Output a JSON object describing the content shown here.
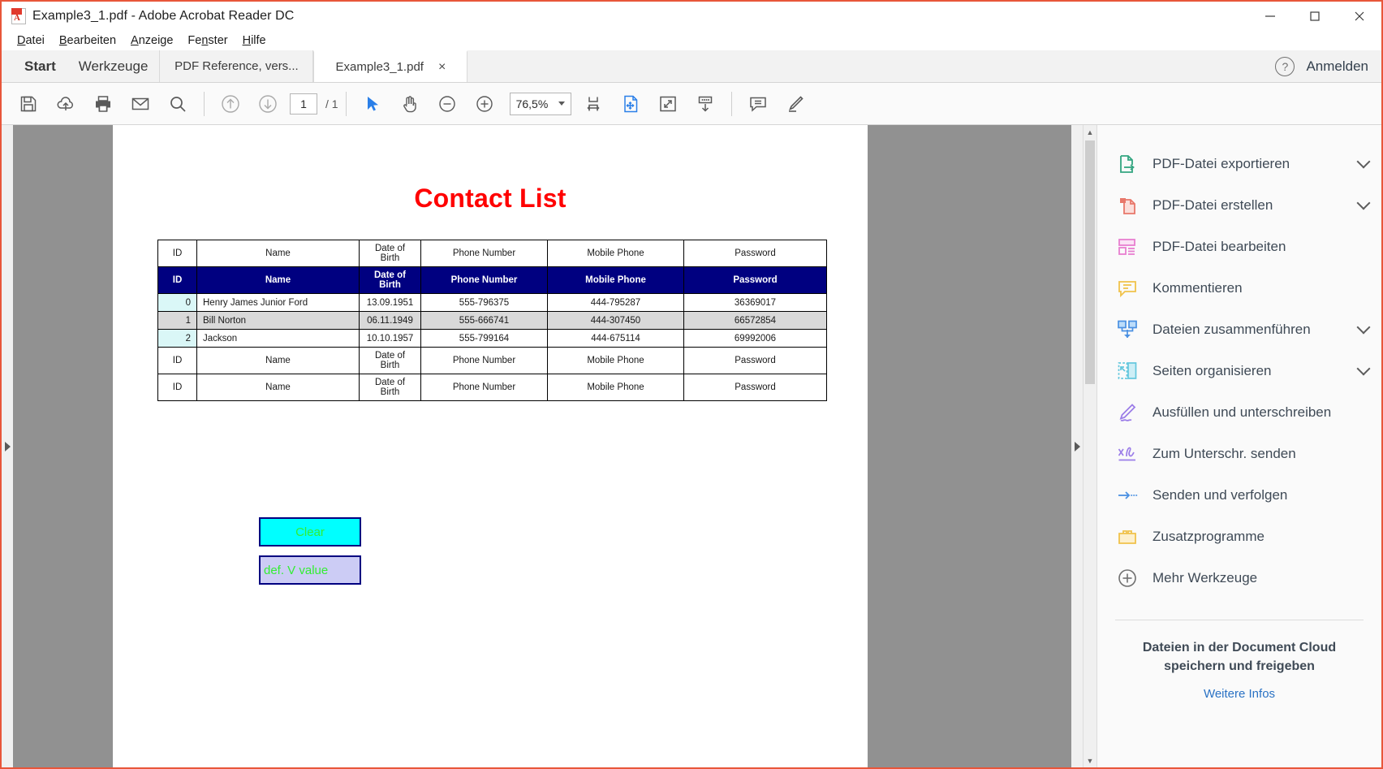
{
  "window": {
    "title": "Example3_1.pdf - Adobe Acrobat Reader DC",
    "app_icon": "pdf-document-icon",
    "minimize": "minimize-icon",
    "maximize": "maximize-icon",
    "close": "close-icon"
  },
  "menubar": {
    "items": [
      {
        "label": "Datei",
        "accel": "D"
      },
      {
        "label": "Bearbeiten",
        "accel": "B"
      },
      {
        "label": "Anzeige",
        "accel": "A"
      },
      {
        "label": "Fenster",
        "accel": "n"
      },
      {
        "label": "Hilfe",
        "accel": "H"
      }
    ]
  },
  "tabbar": {
    "home_label": "Start",
    "tools_label": "Werkzeuge",
    "doc_tabs": [
      {
        "label": "PDF Reference, vers...",
        "active": false,
        "close": ""
      },
      {
        "label": "Example3_1.pdf",
        "active": true,
        "close": "×"
      }
    ],
    "help_glyph": "?",
    "signin_label": "Anmelden"
  },
  "toolbar": {
    "icons": [
      {
        "name": "save-icon",
        "title": "Speichern"
      },
      {
        "name": "upload-cloud-icon",
        "title": "In Cloud speichern"
      },
      {
        "name": "print-icon",
        "title": "Drucken"
      },
      {
        "name": "email-icon",
        "title": "E-Mail"
      },
      {
        "name": "search-icon",
        "title": "Suchen"
      }
    ],
    "prev_page_icon": "arrow-up-circle-icon",
    "next_page_icon": "arrow-down-circle-icon",
    "page_number": "1",
    "page_total": "/ 1",
    "select_tool_icon": "cursor-arrow-icon",
    "hand_tool_icon": "hand-icon",
    "zoom_out_icon": "zoom-out-icon",
    "zoom_in_icon": "zoom-in-icon",
    "zoom_value": "76,5%",
    "fit_width_icon": "fit-width-icon",
    "fit_page_icon": "fit-page-icon",
    "fullscreen_icon": "fullscreen-icon",
    "scroll_mode_icon": "scroll-down-icon",
    "comment_icon": "comment-icon",
    "highlight_icon": "highlight-pen-icon"
  },
  "document": {
    "title": "Contact List",
    "title_color": "#ff0000",
    "table": {
      "columns": [
        "ID",
        "Name",
        "Date of\nBirth",
        "Phone Number",
        "Mobile Phone",
        "Password"
      ],
      "header_plain": {
        "id": "ID",
        "name": "Name",
        "dob_line1": "Date of",
        "dob_line2": "Birth",
        "phone": "Phone Number",
        "mobile": "Mobile Phone",
        "password": "Password"
      },
      "header_blue": {
        "id": "ID",
        "name": "Name",
        "dob_line1": "Date of",
        "dob_line2": "Birth",
        "phone": "Phone Number",
        "mobile": "Mobile Phone",
        "password": "Password"
      },
      "header_blue_bg": "#000080",
      "rows": [
        {
          "id": "0",
          "name": "Henry James Junior Ford",
          "dob": "13.09.1951",
          "phone": "555-796375",
          "mobile": "444-795287",
          "password": "36369017"
        },
        {
          "id": "1",
          "name": "Bill Norton",
          "dob": "06.11.1949",
          "phone": "555-666741",
          "mobile": "444-307450",
          "password": "66572854"
        },
        {
          "id": "2",
          "name": "Jackson",
          "dob": "10.10.1957",
          "phone": "555-799164",
          "mobile": "444-675114",
          "password": "69992006"
        }
      ],
      "footer_rows": [
        {
          "id": "ID",
          "name": "Name",
          "dob_line1": "Date of",
          "dob_line2": "Birth",
          "phone": "Phone Number",
          "mobile": "Mobile Phone",
          "password": "Password"
        },
        {
          "id": "ID",
          "name": "Name",
          "dob_line1": "Date of",
          "dob_line2": "Birth",
          "phone": "Phone Number",
          "mobile": "Mobile Phone",
          "password": "Password"
        }
      ]
    },
    "buttons": [
      {
        "label": "Clear",
        "bg": "#00ffff",
        "text_color": "#33ee33",
        "border": "#000080"
      },
      {
        "label": "def. V value",
        "bg": "#ccccf5",
        "text_color": "#33ee33",
        "border": "#000080"
      }
    ]
  },
  "tools_panel": {
    "items": [
      {
        "label": "PDF-Datei exportieren",
        "icon": "export-pdf-icon",
        "chevron": true
      },
      {
        "label": "PDF-Datei erstellen",
        "icon": "create-pdf-icon",
        "chevron": true
      },
      {
        "label": "PDF-Datei bearbeiten",
        "icon": "edit-pdf-icon",
        "chevron": false
      },
      {
        "label": "Kommentieren",
        "icon": "comment-bubble-icon",
        "chevron": false
      },
      {
        "label": "Dateien zusammenführen",
        "icon": "combine-files-icon",
        "chevron": true
      },
      {
        "label": "Seiten organisieren",
        "icon": "organize-pages-icon",
        "chevron": true
      },
      {
        "label": "Ausfüllen und unterschreiben",
        "icon": "fill-and-sign-icon",
        "chevron": false
      },
      {
        "label": "Zum Unterschr. senden",
        "icon": "send-for-signature-icon",
        "chevron": false
      },
      {
        "label": "Senden und verfolgen",
        "icon": "send-and-track-icon",
        "chevron": false
      },
      {
        "label": "Zusatzprogramme",
        "icon": "add-ons-icon",
        "chevron": false
      },
      {
        "label": "Mehr Werkzeuge",
        "icon": "more-tools-icon",
        "chevron": false
      }
    ],
    "cloud_message": "Dateien in der Document Cloud speichern und freigeben",
    "cloud_link": "Weitere Infos"
  },
  "colors": {
    "accent_orange": "#e8563a",
    "table_header_blue": "#000080",
    "title_red": "#ff0000",
    "link_blue": "#2a72c4"
  }
}
